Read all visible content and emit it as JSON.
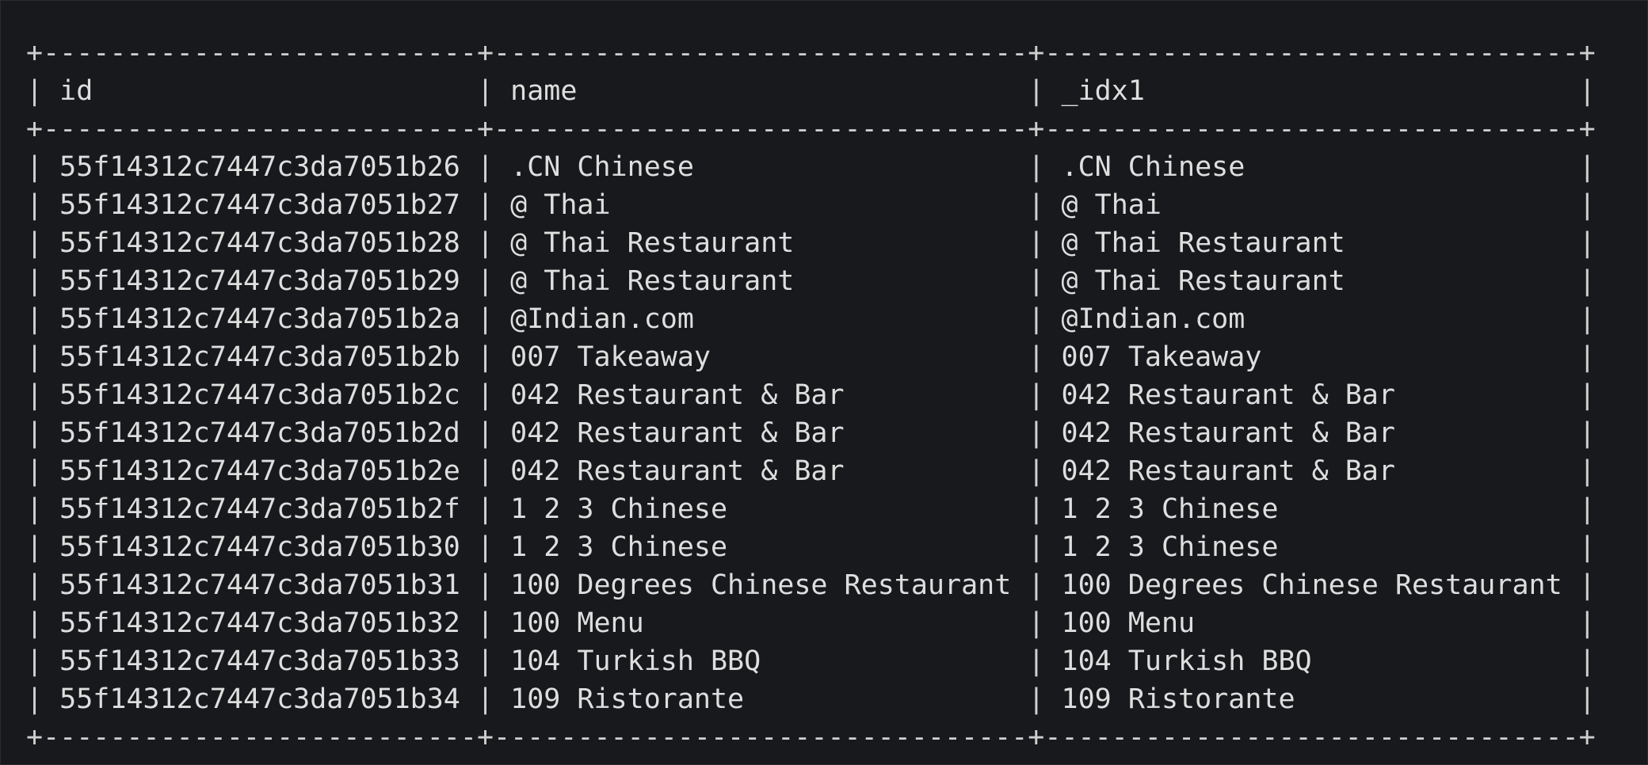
{
  "terminal": {
    "columns": [
      "id",
      "name",
      "_idx1"
    ],
    "rows": [
      [
        "55f14312c7447c3da7051b26",
        ".CN Chinese",
        ".CN Chinese"
      ],
      [
        "55f14312c7447c3da7051b27",
        "@ Thai",
        "@ Thai"
      ],
      [
        "55f14312c7447c3da7051b28",
        "@ Thai Restaurant",
        "@ Thai Restaurant"
      ],
      [
        "55f14312c7447c3da7051b29",
        "@ Thai Restaurant",
        "@ Thai Restaurant"
      ],
      [
        "55f14312c7447c3da7051b2a",
        "@Indian.com",
        "@Indian.com"
      ],
      [
        "55f14312c7447c3da7051b2b",
        "007 Takeaway",
        "007 Takeaway"
      ],
      [
        "55f14312c7447c3da7051b2c",
        "042 Restaurant & Bar",
        "042 Restaurant & Bar"
      ],
      [
        "55f14312c7447c3da7051b2d",
        "042 Restaurant & Bar",
        "042 Restaurant & Bar"
      ],
      [
        "55f14312c7447c3da7051b2e",
        "042 Restaurant & Bar",
        "042 Restaurant & Bar"
      ],
      [
        "55f14312c7447c3da7051b2f",
        "1 2 3 Chinese",
        "1 2 3 Chinese"
      ],
      [
        "55f14312c7447c3da7051b30",
        "1 2 3 Chinese",
        "1 2 3 Chinese"
      ],
      [
        "55f14312c7447c3da7051b31",
        "100 Degrees Chinese Restaurant",
        "100 Degrees Chinese Restaurant"
      ],
      [
        "55f14312c7447c3da7051b32",
        "100 Menu",
        "100 Menu"
      ],
      [
        "55f14312c7447c3da7051b33",
        "104 Turkish BBQ",
        "104 Turkish BBQ"
      ],
      [
        "55f14312c7447c3da7051b34",
        "109 Ristorante",
        "109 Ristorante"
      ]
    ]
  }
}
